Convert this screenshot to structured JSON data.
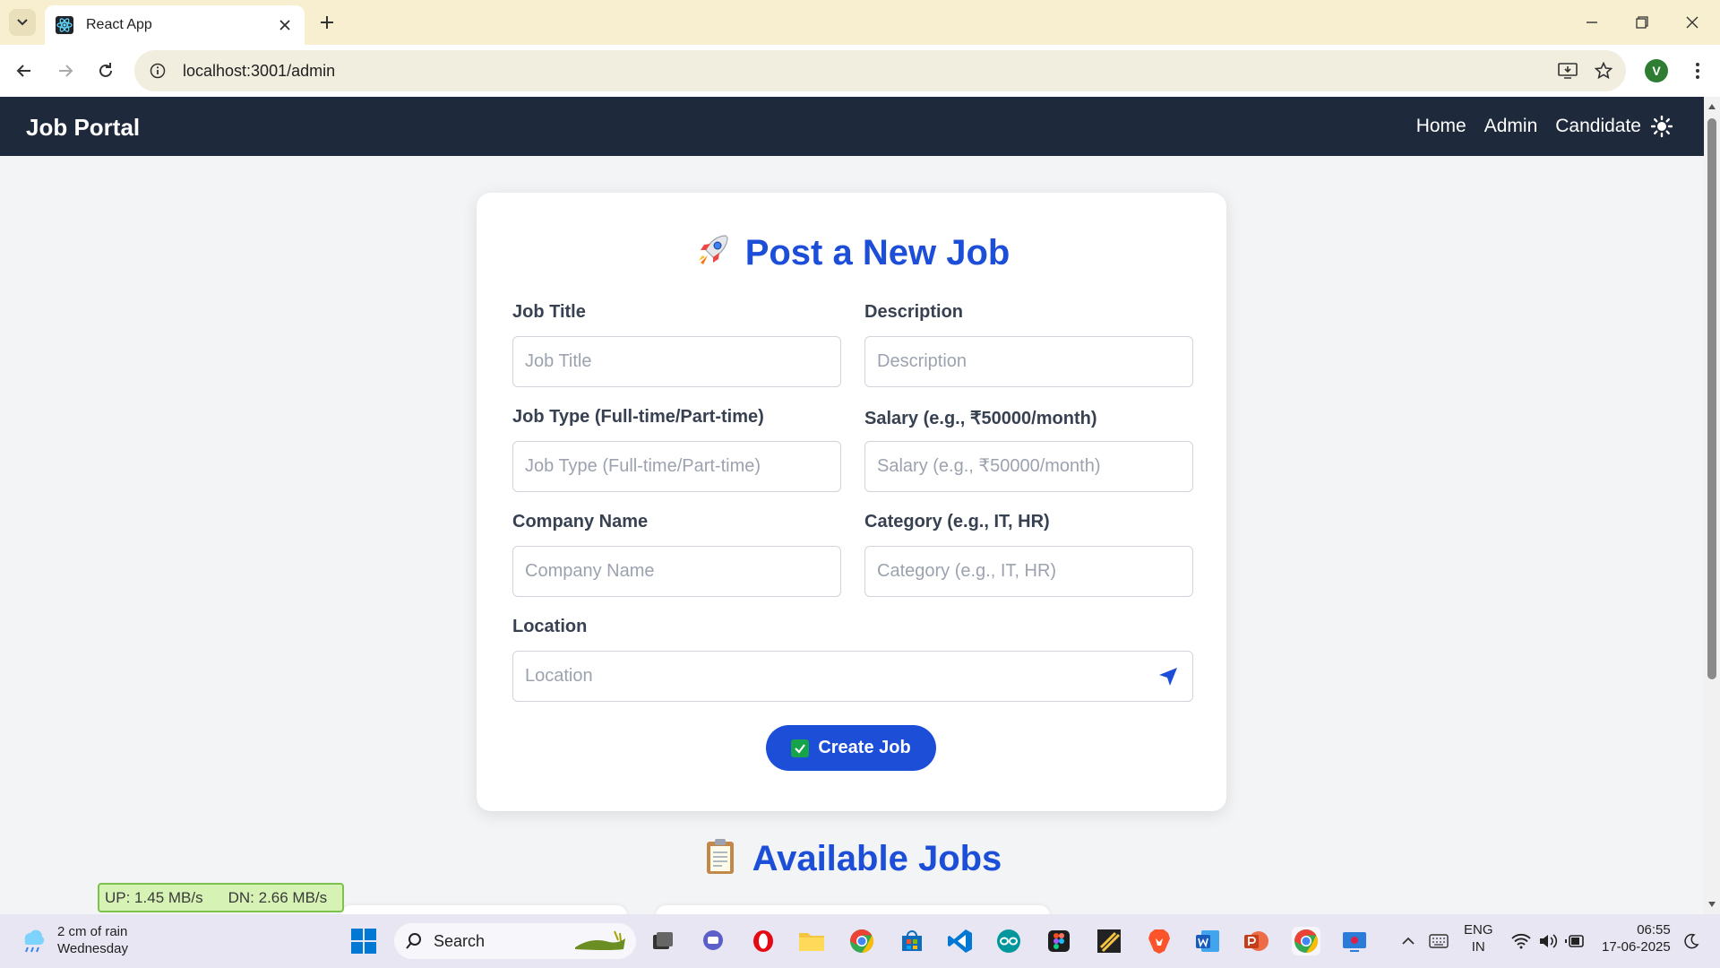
{
  "browser": {
    "tab_title": "React App",
    "url": "localhost:3001/admin",
    "profile_initial": "V"
  },
  "navbar": {
    "brand": "Job Portal",
    "links": [
      "Home",
      "Admin",
      "Candidate"
    ]
  },
  "form": {
    "title": "Post a New Job",
    "fields": {
      "job_title": {
        "label": "Job Title",
        "placeholder": "Job Title",
        "value": ""
      },
      "description": {
        "label": "Description",
        "placeholder": "Description",
        "value": ""
      },
      "job_type": {
        "label": "Job Type (Full-time/Part-time)",
        "placeholder": "Job Type (Full-time/Part-time)",
        "value": ""
      },
      "salary": {
        "label": "Salary (e.g., ₹50000/month)",
        "placeholder": "Salary (e.g., ₹50000/month)",
        "value": ""
      },
      "company": {
        "label": "Company Name",
        "placeholder": "Company Name",
        "value": ""
      },
      "category": {
        "label": "Category (e.g., IT, HR)",
        "placeholder": "Category (e.g., IT, HR)",
        "value": ""
      },
      "location": {
        "label": "Location",
        "placeholder": "Location",
        "value": ""
      }
    },
    "submit_label": "Create Job"
  },
  "jobs_section": {
    "title": "Available Jobs"
  },
  "overlay": {
    "up": "UP: 1.45 MB/s",
    "down": "DN: 2.66 MB/s"
  },
  "taskbar": {
    "weather_line1": "2 cm of rain",
    "weather_line2": "Wednesday",
    "search_label": "Search",
    "lang_line1": "ENG",
    "lang_line2": "IN",
    "time": "06:55",
    "date": "17-06-2025"
  },
  "colors": {
    "accent": "#1d4ed8",
    "navbar_bg": "#1e293b",
    "page_bg": "#f3f4f6"
  }
}
